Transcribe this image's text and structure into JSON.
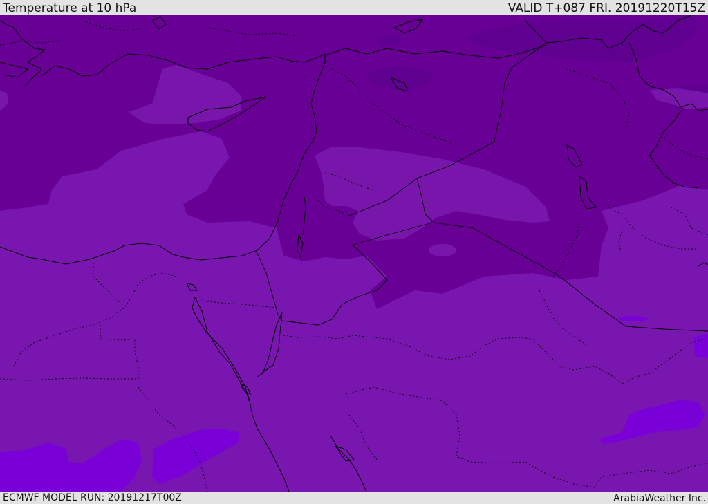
{
  "header": {
    "title": "Temperature at 10 hPa",
    "valid_time": "VALID T+087 FRI. 20191220T15Z"
  },
  "footer": {
    "model_run": "ECMWF MODEL RUN: 20191217T00Z",
    "credit": "ArabiaWeather Inc."
  },
  "map": {
    "field": "temperature",
    "level": "10 hPa",
    "colors": {
      "darkest": "#5f0090",
      "dark": "#690096",
      "mid": "#7816ac",
      "base": "#7a16b0",
      "light": "#7a00d8",
      "coast": "#000000"
    }
  }
}
